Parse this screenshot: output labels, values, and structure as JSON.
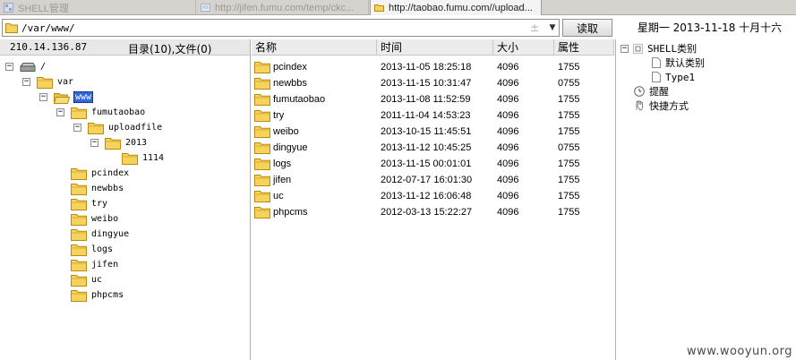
{
  "tabs": [
    {
      "title": "SHELL管理",
      "active": false
    },
    {
      "title": "http://jifen.fumu.com/temp/ckc...",
      "active": false
    },
    {
      "title": "http://taobao.fumu.com//upload...",
      "active": true
    }
  ],
  "address": {
    "path": "/var/www/",
    "plus": "±",
    "dropdown": "▼"
  },
  "read_button": "读取",
  "date_display": "星期一 2013-11-18 十月十六",
  "left_panel": {
    "ip": "210.14.136.87",
    "counts": "目录(10),文件(0)",
    "tree": [
      {
        "label": "/",
        "toggle": "⊟",
        "icon": "drive-icon"
      },
      {
        "label": "var",
        "toggle": "⊟",
        "icon": "folder-icon"
      },
      {
        "label": "www",
        "toggle": "⊟",
        "icon": "folder-open-icon",
        "selected": true
      },
      {
        "label": "fumutaobao",
        "toggle": "⊟",
        "icon": "folder-icon"
      },
      {
        "label": "uploadfile",
        "toggle": "⊟",
        "icon": "folder-icon"
      },
      {
        "label": "2013",
        "toggle": "⊟",
        "icon": "folder-icon"
      },
      {
        "label": "1114",
        "toggle": "",
        "icon": "folder-icon"
      },
      {
        "label": "pcindex",
        "toggle": "",
        "icon": "folder-icon"
      },
      {
        "label": "newbbs",
        "toggle": "",
        "icon": "folder-icon"
      },
      {
        "label": "try",
        "toggle": "",
        "icon": "folder-icon"
      },
      {
        "label": "weibo",
        "toggle": "",
        "icon": "folder-icon"
      },
      {
        "label": "dingyue",
        "toggle": "",
        "icon": "folder-icon"
      },
      {
        "label": "logs",
        "toggle": "",
        "icon": "folder-icon"
      },
      {
        "label": "jifen",
        "toggle": "",
        "icon": "folder-icon"
      },
      {
        "label": "uc",
        "toggle": "",
        "icon": "folder-icon"
      },
      {
        "label": "phpcms",
        "toggle": "",
        "icon": "folder-icon"
      }
    ]
  },
  "file_list": {
    "headers": {
      "name": "名称",
      "time": "时间",
      "size": "大小",
      "attr": "属性"
    },
    "rows": [
      {
        "name": "pcindex",
        "time": "2013-11-05 18:25:18",
        "size": "4096",
        "attr": "1755"
      },
      {
        "name": "newbbs",
        "time": "2013-11-15 10:31:47",
        "size": "4096",
        "attr": "0755"
      },
      {
        "name": "fumutaobao",
        "time": "2013-11-08 11:52:59",
        "size": "4096",
        "attr": "1755"
      },
      {
        "name": "try",
        "time": "2011-11-04 14:53:23",
        "size": "4096",
        "attr": "1755"
      },
      {
        "name": "weibo",
        "time": "2013-10-15 11:45:51",
        "size": "4096",
        "attr": "1755"
      },
      {
        "name": "dingyue",
        "time": "2013-11-12 10:45:25",
        "size": "4096",
        "attr": "0755"
      },
      {
        "name": "logs",
        "time": "2013-11-15 00:01:01",
        "size": "4096",
        "attr": "1755"
      },
      {
        "name": "jifen",
        "time": "2012-07-17 16:01:30",
        "size": "4096",
        "attr": "1755"
      },
      {
        "name": "uc",
        "time": "2013-11-12 16:06:48",
        "size": "4096",
        "attr": "1755"
      },
      {
        "name": "phpcms",
        "time": "2012-03-13 15:22:27",
        "size": "4096",
        "attr": "1755"
      }
    ]
  },
  "right_panel": {
    "shell_category": "SHELL类别",
    "default_category": "默认类别",
    "type1": "Type1",
    "reminder": "提醒",
    "shortcut": "快捷方式"
  },
  "watermark": "www.wooyun.org",
  "colors": {
    "selection": "#3168d5",
    "folder_fill": "#f5d35c",
    "folder_stroke": "#b88a10"
  }
}
